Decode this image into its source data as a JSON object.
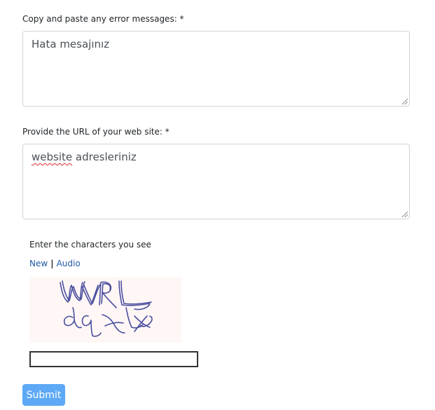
{
  "fields": {
    "error_messages": {
      "label": "Copy and paste any error messages: *",
      "value": "Hata mesajınız"
    },
    "website_url": {
      "label": "Provide the URL of your web site: *",
      "value_word_1": "website",
      "value_word_2": " adresleriniz"
    }
  },
  "captcha": {
    "title": "Enter the characters you see",
    "new_label": "New",
    "separator": "|",
    "audio_label": "Audio",
    "input_value": ""
  },
  "submit_label": "Submit",
  "colors": {
    "link": "#1f5aa6",
    "submit_bg": "#5da9f6",
    "captcha_bg": "#fff6f6",
    "captcha_ink": "#4a4f9e"
  }
}
